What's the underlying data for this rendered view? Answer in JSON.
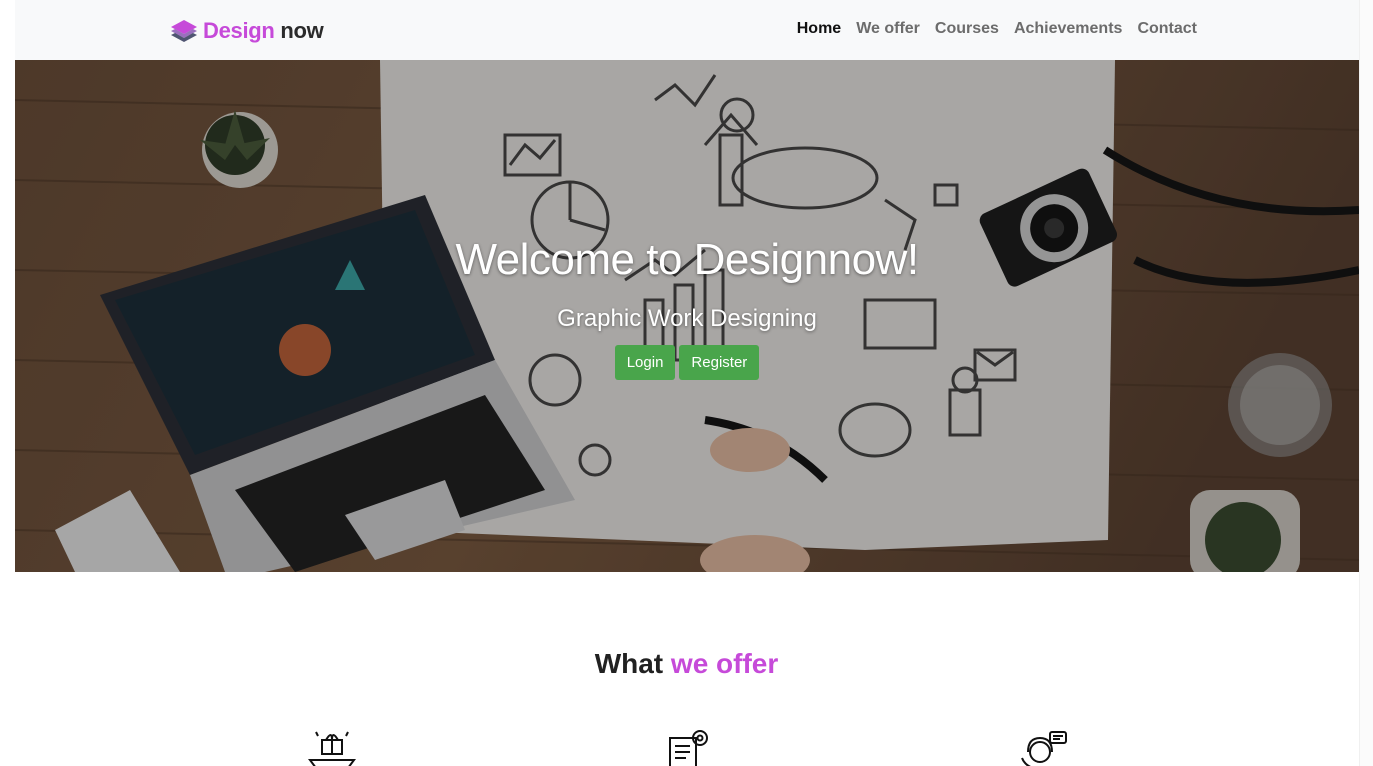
{
  "brand": {
    "name_accent": "Design",
    "name_rest": "now",
    "icon": "layers-icon",
    "accent_color": "#c64ad9"
  },
  "nav": {
    "items": [
      {
        "label": "Home",
        "active": true
      },
      {
        "label": "We offer",
        "active": false
      },
      {
        "label": "Courses",
        "active": false
      },
      {
        "label": "Achievements",
        "active": false
      },
      {
        "label": "Contact",
        "active": false
      }
    ]
  },
  "hero": {
    "title": "Welcome to Designnow!",
    "subtitle": "Graphic Work Designing",
    "login_label": "Login",
    "register_label": "Register",
    "button_color": "#49a54b",
    "background_icon": "desk-business-sketch-image"
  },
  "offer": {
    "title_plain": "What",
    "title_accent": "we offer",
    "icons": [
      "gift-tray-icon",
      "document-gear-icon",
      "support-agent-icon"
    ]
  }
}
